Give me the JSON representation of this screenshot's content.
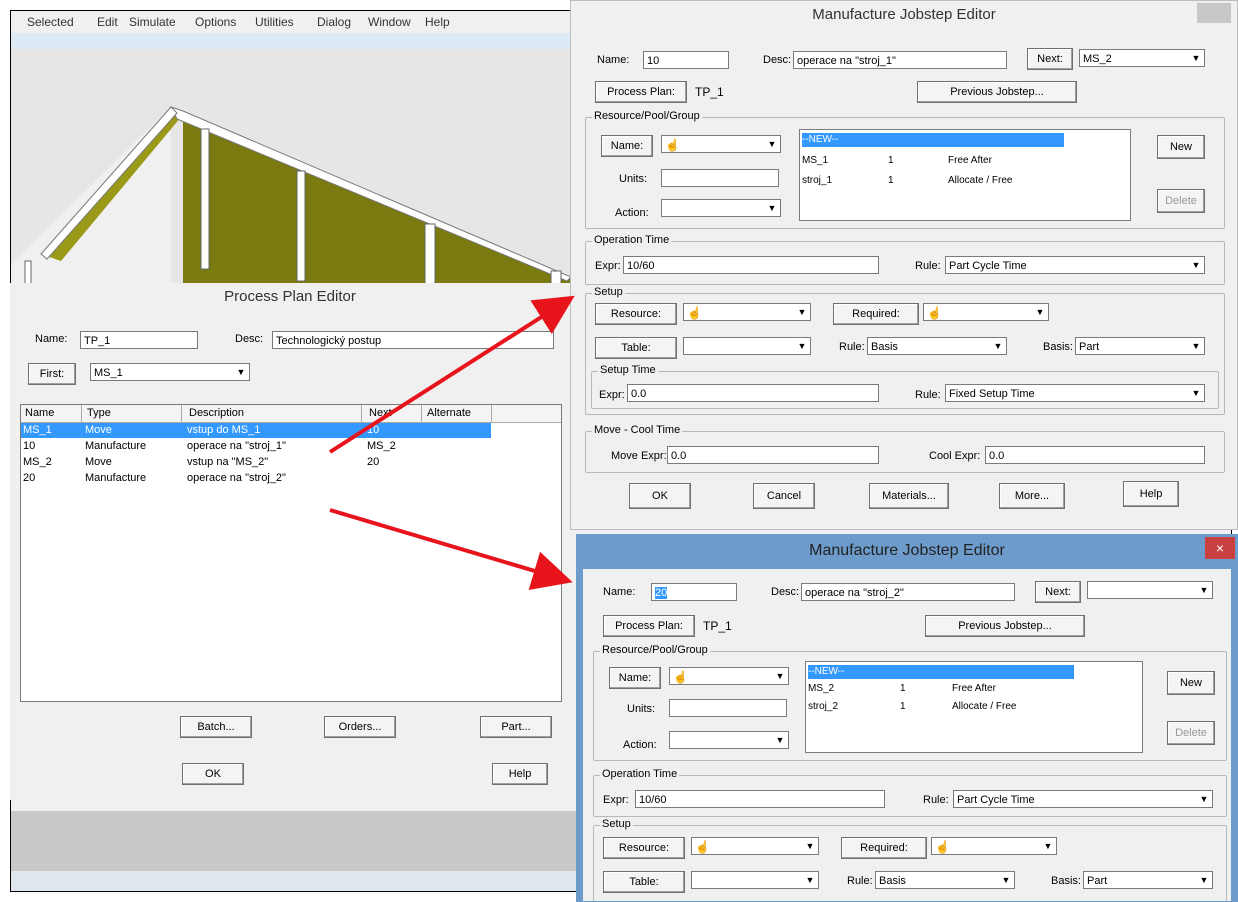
{
  "menu": [
    "Selected",
    "Edit",
    "Simulate",
    "Options",
    "Utilities",
    "Dialog",
    "Window",
    "Help"
  ],
  "process_plan_editor": {
    "title": "Process Plan Editor",
    "name_label": "Name:",
    "name_value": "TP_1",
    "desc_label": "Desc:",
    "desc_value": "Technologický postup",
    "first_button": "First:",
    "first_value": "MS_1",
    "columns": [
      "Name",
      "Type",
      "Description",
      "Next",
      "Alternate"
    ],
    "rows": [
      {
        "name": "MS_1",
        "type": "Move",
        "description": "vstup do MS_1",
        "next": "10",
        "alternate": ""
      },
      {
        "name": "10",
        "type": "Manufacture",
        "description": "operace na \"stroj_1\"",
        "next": "MS_2",
        "alternate": ""
      },
      {
        "name": "MS_2",
        "type": "Move",
        "description": "vstup na \"MS_2\"",
        "next": "20",
        "alternate": ""
      },
      {
        "name": "20",
        "type": "Manufacture",
        "description": "operace na \"stroj_2\"",
        "next": "",
        "alternate": ""
      }
    ],
    "buttons": {
      "batch": "Batch...",
      "orders": "Orders...",
      "part": "Part...",
      "ok": "OK",
      "help": "Help"
    }
  },
  "jobstep1": {
    "title": "Manufacture Jobstep Editor",
    "name_label": "Name:",
    "name_value": "10",
    "desc_label": "Desc:",
    "desc_value": "operace na \"stroj_1\"",
    "next_button": "Next:",
    "next_value": "MS_2",
    "process_plan_button": "Process Plan:",
    "process_plan_value": "TP_1",
    "previous_button": "Previous Jobstep...",
    "resource_group": "Resource/Pool/Group",
    "name_button": "Name:",
    "units_label": "Units:",
    "action_label": "Action:",
    "resource_list": [
      {
        "c1": "--NEW--",
        "c2": "",
        "c3": ""
      },
      {
        "c1": "MS_1",
        "c2": "1",
        "c3": "Free After"
      },
      {
        "c1": "stroj_1",
        "c2": "1",
        "c3": "Allocate / Free"
      }
    ],
    "new_button": "New",
    "delete_button": "Delete",
    "op_time_group": "Operation Time",
    "expr_label": "Expr:",
    "expr_value": "10/60",
    "rule_label": "Rule:",
    "rule_value": "Part Cycle Time",
    "setup_group": "Setup",
    "resource_button": "Resource:",
    "required_button": "Required:",
    "table_button": "Table:",
    "setup_rule_label": "Rule:",
    "setup_rule_value": "Basis",
    "basis_label": "Basis:",
    "basis_value": "Part",
    "setup_time_group": "Setup Time",
    "setup_expr_label": "Expr:",
    "setup_expr_value": "0.0",
    "setup_time_rule_label": "Rule:",
    "setup_time_rule_value": "Fixed Setup Time",
    "move_cool_group": "Move - Cool Time",
    "move_expr_label": "Move Expr:",
    "move_expr_value": "0.0",
    "cool_expr_label": "Cool Expr:",
    "cool_expr_value": "0.0",
    "ok": "OK",
    "cancel": "Cancel",
    "materials": "Materials...",
    "more": "More...",
    "help": "Help"
  },
  "jobstep2": {
    "title": "Manufacture Jobstep Editor",
    "close": "×",
    "name_label": "Name:",
    "name_value": "20",
    "desc_label": "Desc:",
    "desc_value": "operace na \"stroj_2\"",
    "next_button": "Next:",
    "next_value": "",
    "process_plan_button": "Process Plan:",
    "process_plan_value": "TP_1",
    "previous_button": "Previous Jobstep...",
    "resource_group": "Resource/Pool/Group",
    "name_button": "Name:",
    "units_label": "Units:",
    "action_label": "Action:",
    "resource_list": [
      {
        "c1": "--NEW--",
        "c2": "",
        "c3": ""
      },
      {
        "c1": "MS_2",
        "c2": "1",
        "c3": "Free After"
      },
      {
        "c1": "stroj_2",
        "c2": "1",
        "c3": "Allocate / Free"
      }
    ],
    "new_button": "New",
    "delete_button": "Delete",
    "op_time_group": "Operation Time",
    "expr_label": "Expr:",
    "expr_value": "10/60",
    "rule_label": "Rule:",
    "rule_value": "Part Cycle Time",
    "setup_group": "Setup",
    "resource_button": "Resource:",
    "required_button": "Required:",
    "table_button": "Table:",
    "setup_rule_label": "Rule:",
    "setup_rule_value": "Basis",
    "basis_label": "Basis:",
    "basis_value": "Part"
  },
  "colors": {
    "selection": "#3399ff",
    "arrow": "#e8141c",
    "wall": "#7a7a10",
    "titlebar_active": "#6d9ccc"
  }
}
